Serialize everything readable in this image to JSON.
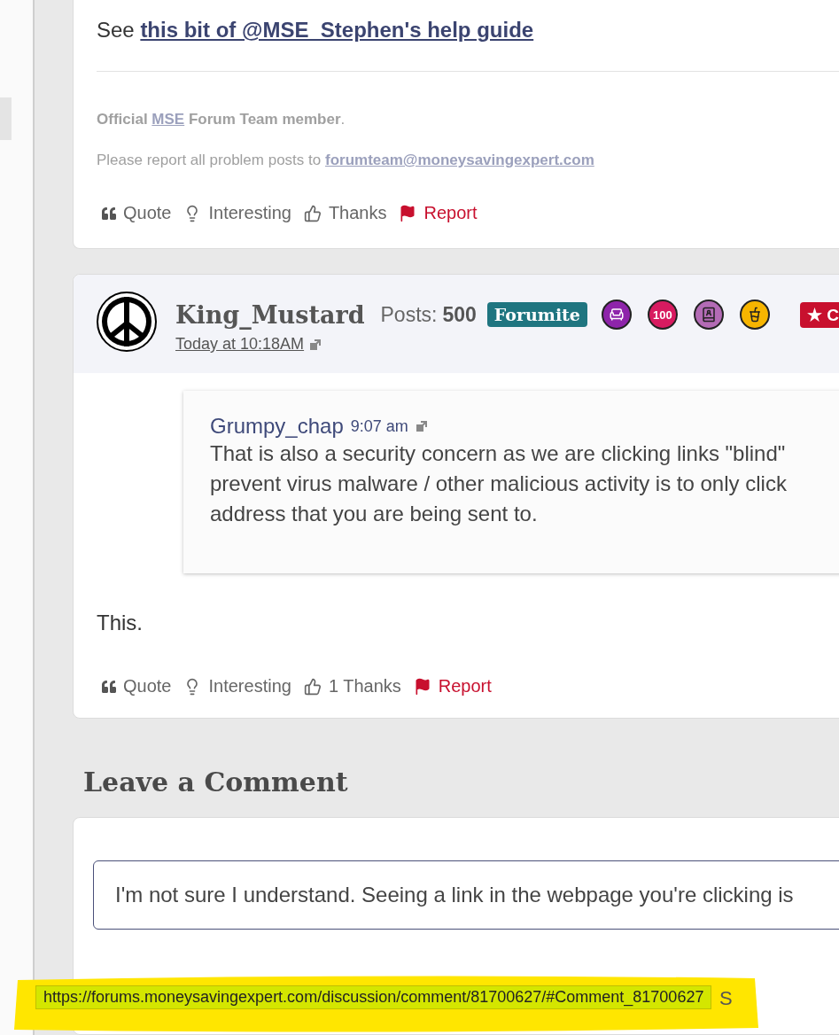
{
  "first_post": {
    "body": [
      {
        "kind": "plain",
        "text": "See "
      },
      {
        "kind": "link",
        "text": "this bit of @MSE_Stephen's help guide"
      }
    ],
    "signature": [
      [
        {
          "kind": "bold",
          "text": "Official "
        },
        {
          "kind": "link",
          "text": "MSE"
        },
        {
          "kind": "bold",
          "text": " Forum Team member"
        },
        {
          "kind": "plain",
          "text": "."
        }
      ],
      [
        {
          "kind": "plain",
          "text": "Please report all problem posts to "
        },
        {
          "kind": "link",
          "text": "forumteam@moneysavingexpert.com"
        }
      ]
    ],
    "actions": [
      {
        "kind": "quote",
        "label": "Quote"
      },
      {
        "kind": "interesting",
        "label": "Interesting"
      },
      {
        "kind": "thanks",
        "label": "Thanks"
      },
      {
        "kind": "report",
        "label": "Report"
      }
    ]
  },
  "second_post": {
    "author": "King_Mustard",
    "posts_label": "Posts:",
    "posts_count": "500",
    "rank": "Forumite",
    "badges": [
      {
        "kind": "armchair",
        "color": "#8e24aa"
      },
      {
        "kind": "text",
        "text": "100",
        "color": "#d81b60"
      },
      {
        "kind": "contacts",
        "color": "#b36bb5"
      },
      {
        "kind": "food",
        "color": "#f7b500"
      }
    ],
    "role_badge": "★ C",
    "time": "Today at 10:18AM",
    "quote": {
      "author": "Grumpy_chap",
      "time": "9:07 am",
      "lines": [
        "That is also a security concern as we are clicking links \"blind\"",
        "prevent virus malware / other malicious activity is to only click",
        "address that you are being sent to."
      ]
    },
    "body": "This.",
    "actions": [
      {
        "kind": "quote",
        "label": "Quote"
      },
      {
        "kind": "interesting",
        "label": "Interesting"
      },
      {
        "kind": "thanks",
        "label": "1 Thanks"
      },
      {
        "kind": "report",
        "label": "Report"
      }
    ]
  },
  "comment": {
    "heading": "Leave a Comment",
    "value": "I'm not sure I understand. Seeing a link in the webpage you're clicking is",
    "trailing": "S"
  },
  "status_url": "https://forums.moneysavingexpert.com/discussion/comment/81700627/#Comment_81700627"
}
